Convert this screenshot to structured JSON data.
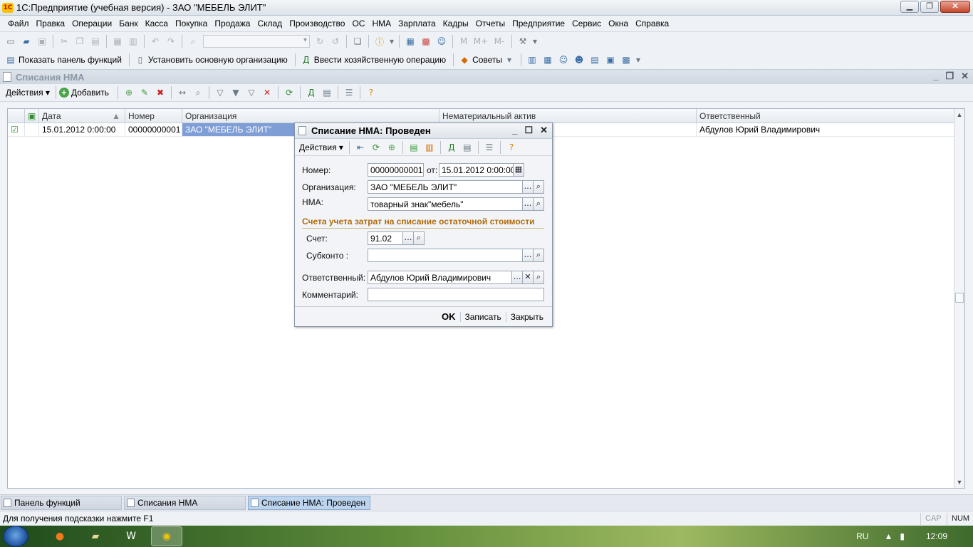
{
  "window": {
    "title": "1С:Предприятие (учебная версия) - ЗАО \"МЕБЕЛЬ ЭЛИТ\"",
    "logo": "1С"
  },
  "menu": [
    "Файл",
    "Правка",
    "Операции",
    "Банк",
    "Касса",
    "Покупка",
    "Продажа",
    "Склад",
    "Производство",
    "ОС",
    "НМА",
    "Зарплата",
    "Кадры",
    "Отчеты",
    "Предприятие",
    "Сервис",
    "Окна",
    "Справка"
  ],
  "toolbar2": {
    "show_panel": "Показать панель функций",
    "set_org": "Установить основную организацию",
    "enter_op": "Ввести хозяйственную операцию",
    "tips": "Советы"
  },
  "list": {
    "title": "Списания НМА",
    "actions": "Действия",
    "add": "Добавить",
    "columns": [
      "Дата",
      "Номер",
      "Организация",
      "Нематериальный актив",
      "Ответственный"
    ],
    "row": {
      "date": "15.01.2012 0:00:00",
      "number": "00000000001",
      "org": "ЗАО \"МЕБЕЛЬ ЭЛИТ\"",
      "asset": "",
      "responsible": "Абдулов Юрий Владимирович"
    }
  },
  "dialog": {
    "title": "Списание НМА: Проведен",
    "actions": "Действия",
    "number_label": "Номер:",
    "number_value": "00000000001",
    "from_label": "от:",
    "date_value": "15.01.2012  0:00:00",
    "org_label": "Организация:",
    "org_value": "ЗАО \"МЕБЕЛЬ ЭЛИТ\"",
    "nma_label": "НМА:",
    "nma_value": "товарный знак\"мебель\"",
    "section_title": "Счета учета затрат на списание остаточной стоимости",
    "account_label": "Счет:",
    "account_value": "91.02",
    "subkonto_label": "Субконто :",
    "subkonto_value": "",
    "resp_label": "Ответственный:",
    "resp_value": "Абдулов Юрий Владимирович",
    "comment_label": "Комментарий:",
    "comment_value": "",
    "ok": "OK",
    "save": "Записать",
    "close": "Закрыть"
  },
  "tabs": [
    "Панель функций",
    "Списания НМА",
    "Списание НМА: Проведен"
  ],
  "status": {
    "hint": "Для получения подсказки нажмите F1",
    "cap": "CAP",
    "num": "NUM"
  },
  "taskbar": {
    "lang": "RU",
    "time": "12:09"
  }
}
